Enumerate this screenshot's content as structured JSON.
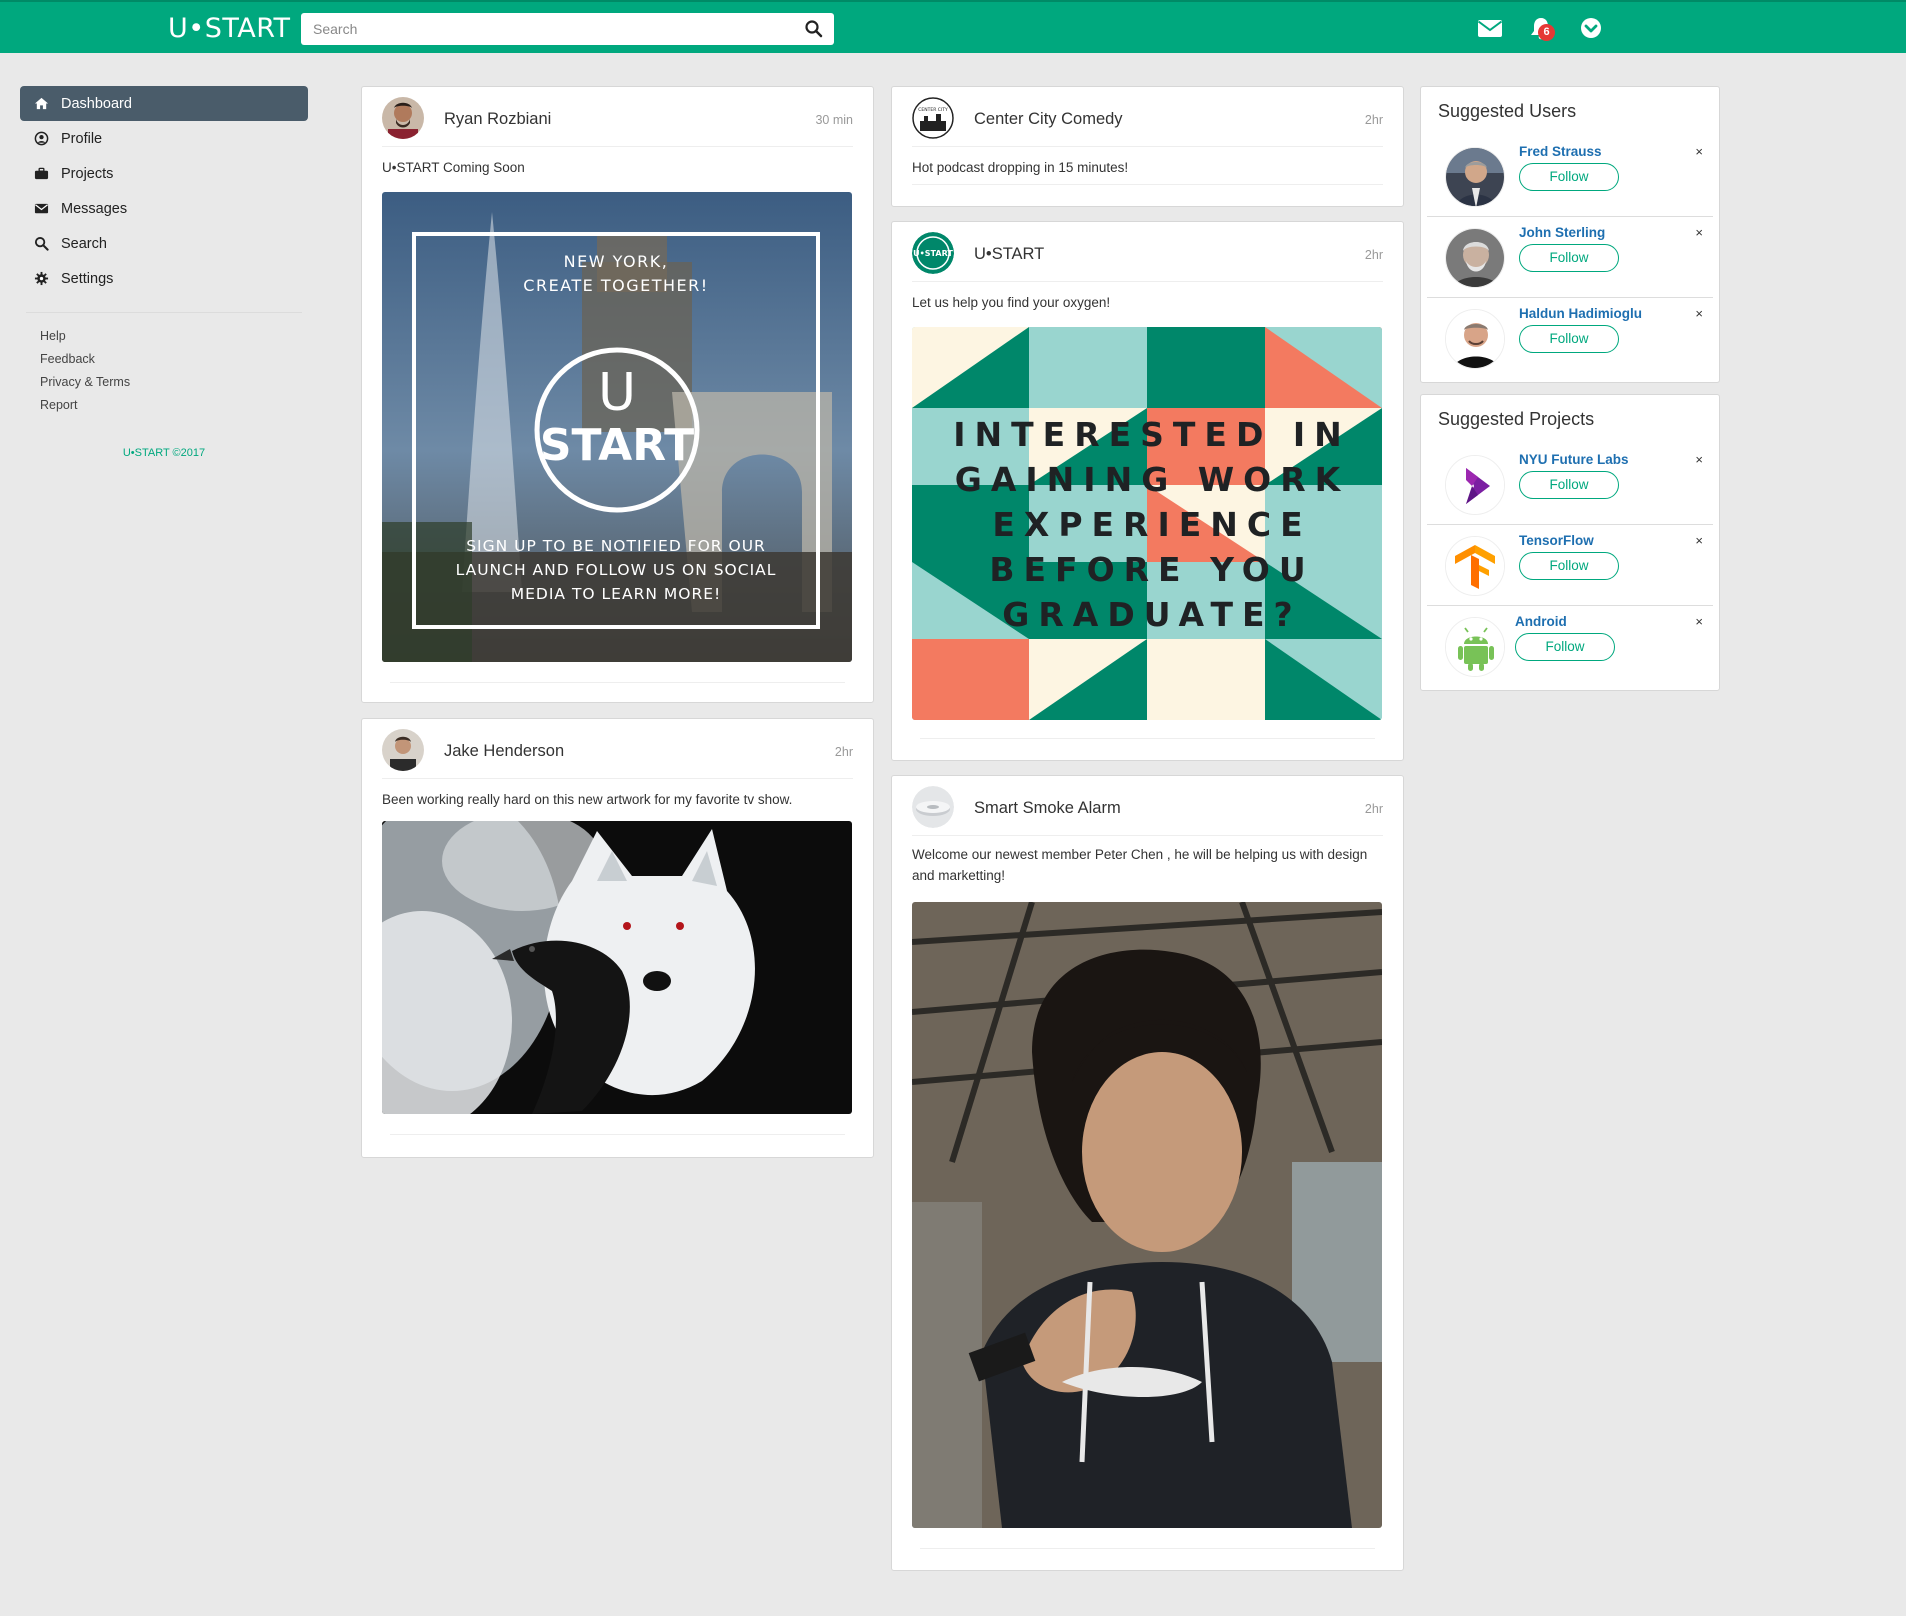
{
  "brand": {
    "logo": "U•START",
    "accent": "#00a87e",
    "nav_active_bg": "#4a5c6a",
    "link_color": "#1e6fb0",
    "badge_color": "#e53935"
  },
  "search": {
    "placeholder": "Search"
  },
  "topbar": {
    "icons": [
      "envelope-icon",
      "bell-icon",
      "chevron-circle-down-icon"
    ],
    "notifications_count": "6"
  },
  "sidebar": {
    "items": [
      {
        "label": "Dashboard",
        "icon": "home-icon",
        "active": true
      },
      {
        "label": "Profile",
        "icon": "user-circle-icon"
      },
      {
        "label": "Projects",
        "icon": "briefcase-icon"
      },
      {
        "label": "Messages",
        "icon": "envelope-icon"
      },
      {
        "label": "Search",
        "icon": "search-icon"
      },
      {
        "label": "Settings",
        "icon": "gear-icon"
      }
    ],
    "links": [
      "Help",
      "Feedback",
      "Privacy & Terms",
      "Report"
    ],
    "copyright": "U•START ©2017"
  },
  "posts": [
    {
      "author": "Ryan Rozbiani",
      "time": "30 min",
      "text": "U•START Coming Soon",
      "image": {
        "line1": "NEW YORK,",
        "line2": "CREATE TOGETHER!",
        "logo_top": "U",
        "logo_bottom": "START",
        "footer1": "SIGN UP TO BE NOTIFIED FOR OUR",
        "footer2": "LAUNCH AND FOLLOW US ON SOCIAL",
        "footer3": "MEDIA TO LEARN MORE!"
      }
    },
    {
      "author": "Jake Henderson",
      "time": "2hr",
      "text": "Been working really hard on this new artwork for my favorite tv show."
    },
    {
      "author": "Center City Comedy",
      "time": "2hr",
      "text": "Hot podcast dropping in 15 minutes!",
      "avatar_text": "CENTER CITY COMEDY"
    },
    {
      "author": "U•START",
      "time": "2hr",
      "text": "Let us help you find your oxygen!",
      "avatar_text": "U•START",
      "image": {
        "lines": [
          "INTERESTED IN",
          "GAINING WORK",
          "EXPERIENCE",
          "BEFORE YOU",
          "GRADUATE?"
        ]
      }
    },
    {
      "author": "Smart Smoke Alarm",
      "time": "2hr",
      "text": "Welcome our newest member Peter Chen , he will be helping us with design and marketting!"
    }
  ],
  "suggested_users": {
    "title": "Suggested Users",
    "items": [
      {
        "name": "Fred Strauss",
        "button": "Follow",
        "close": "×"
      },
      {
        "name": "John Sterling",
        "button": "Follow",
        "close": "×"
      },
      {
        "name": "Haldun Hadimioglu",
        "button": "Follow",
        "close": "×"
      }
    ]
  },
  "suggested_projects": {
    "title": "Suggested Projects",
    "items": [
      {
        "name": "NYU Future Labs",
        "button": "Follow",
        "close": "×",
        "icon": "nyu-future-labs-logo-icon"
      },
      {
        "name": "TensorFlow",
        "button": "Follow",
        "close": "×",
        "icon": "tensorflow-logo-icon"
      },
      {
        "name": "Android",
        "button": "Follow",
        "close": "×",
        "icon": "android-logo-icon"
      }
    ]
  }
}
